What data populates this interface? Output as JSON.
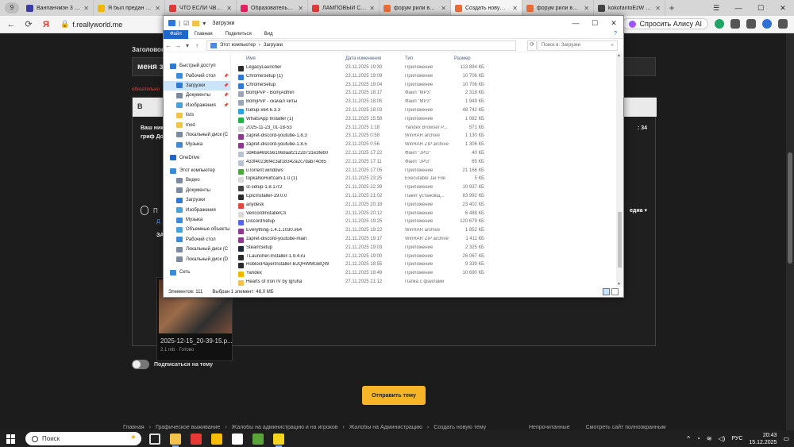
{
  "browser": {
    "tab_counter": "9",
    "tabs": [
      {
        "title": "Ванпанчмэн 3 сезон",
        "color": "#3a3aa8",
        "active": false
      },
      {
        "title": "Я был предан товар",
        "color": "#f4b400",
        "active": false
      },
      {
        "title": "ЧТО ЕСЛИ ЧВК \"ВАГ",
        "color": "#e53935",
        "active": false
      },
      {
        "title": "Образовательный п",
        "color": "#e91e63",
        "active": false
      },
      {
        "title": "ЛАМПОВЫЙ СТР",
        "color": "#e53935",
        "active": false
      },
      {
        "title": "форум рили ворлд -",
        "color": "#ef6c36",
        "active": false
      },
      {
        "title": "Создать новую те",
        "color": "#ef6c36",
        "active": true
      },
      {
        "title": "форум рили ворлд",
        "color": "#ef6c36",
        "active": false
      },
      {
        "title": "kokofantoEzW - Reali",
        "color": "#444444",
        "active": false
      }
    ],
    "url": "f.reallyworld.me",
    "alice_label": "Спросить Алису AI"
  },
  "forum": {
    "header": "Заголовок",
    "title_value": "меня за",
    "required_note": "обязательно",
    "editor_bold": "B",
    "editor_line1": "Ваш ник:",
    "editor_line2": "гриф Дом",
    "editor_right": ": 34",
    "attach_label": "П",
    "media_dropdown": "едиа ▾",
    "link_letter": "Д",
    "section_letter": "ЗА",
    "attachment": {
      "filename": "2025-12-15_20-39-15.p...",
      "meta": "2.1 mb · Готово"
    },
    "subscribe_label": "Подписаться на тему",
    "submit_label": "Отправить тему",
    "footer_crumbs": [
      "Главная",
      "›",
      "Графическое выживание",
      "›",
      "Жалобы на администрацию и на игроков",
      "›",
      "Жалобы на Администрацию",
      "›",
      "Создать новую тему"
    ],
    "footer_right": [
      "Непрочитанные",
      "Смотреть сайт полноэкранным"
    ]
  },
  "explorer": {
    "title": "Загрузки",
    "ribbon_tabs": [
      "Файл",
      "Главная",
      "Поделиться",
      "Вид"
    ],
    "path": [
      "Этот компьютер",
      "›",
      "Загрузки"
    ],
    "search_placeholder": "Поиск в: Загрузки",
    "columns": {
      "name": "Имя",
      "date": "Дата изменения",
      "type": "Тип",
      "size": "Размер"
    },
    "nav": [
      {
        "label": "Быстрый доступ",
        "level": 1,
        "color": "#2f78d4",
        "pin": false,
        "selected": false
      },
      {
        "label": "Рабочий стол",
        "level": 2,
        "color": "#3b8bd9",
        "pin": true,
        "selected": false
      },
      {
        "label": "Загрузки",
        "level": 2,
        "color": "#2f78d4",
        "pin": true,
        "selected": true
      },
      {
        "label": "Документы",
        "level": 2,
        "color": "#7a8aa0",
        "pin": true,
        "selected": false
      },
      {
        "label": "Изображения",
        "level": 2,
        "color": "#4aa0d8",
        "pin": true,
        "selected": false
      },
      {
        "label": "lists",
        "level": 2,
        "color": "#f3c24d",
        "pin": false,
        "selected": false
      },
      {
        "label": "mod",
        "level": 2,
        "color": "#f3c24d",
        "pin": false,
        "selected": false
      },
      {
        "label": "Локальный диск (C",
        "level": 2,
        "color": "#7a8aa0",
        "pin": false,
        "selected": false
      },
      {
        "label": "Музыка",
        "level": 2,
        "color": "#3b8bd9",
        "pin": false,
        "selected": false
      },
      {
        "label": "",
        "level": 0,
        "color": "",
        "pin": false,
        "selected": false
      },
      {
        "label": "OneDrive",
        "level": 1,
        "color": "#1c67c9",
        "pin": false,
        "selected": false
      },
      {
        "label": "",
        "level": 0,
        "color": "",
        "pin": false,
        "selected": false
      },
      {
        "label": "Этот компьютер",
        "level": 1,
        "color": "#3b8bd9",
        "pin": false,
        "selected": false
      },
      {
        "label": "Видео",
        "level": 2,
        "color": "#7a8aa0",
        "pin": false,
        "selected": false
      },
      {
        "label": "Документы",
        "level": 2,
        "color": "#7a8aa0",
        "pin": false,
        "selected": false
      },
      {
        "label": "Загрузки",
        "level": 2,
        "color": "#2f78d4",
        "pin": false,
        "selected": false
      },
      {
        "label": "Изображения",
        "level": 2,
        "color": "#4aa0d8",
        "pin": false,
        "selected": false
      },
      {
        "label": "Музыка",
        "level": 2,
        "color": "#3b8bd9",
        "pin": false,
        "selected": false
      },
      {
        "label": "Объемные объекты",
        "level": 2,
        "color": "#4aa0d8",
        "pin": false,
        "selected": false
      },
      {
        "label": "Рабочий стол",
        "level": 2,
        "color": "#3b8bd9",
        "pin": false,
        "selected": false
      },
      {
        "label": "Локальный диск (C",
        "level": 2,
        "color": "#7a8aa0",
        "pin": false,
        "selected": false
      },
      {
        "label": "Локальный диск (D",
        "level": 2,
        "color": "#7a8aa0",
        "pin": false,
        "selected": false
      },
      {
        "label": "",
        "level": 0,
        "color": "",
        "pin": false,
        "selected": false
      },
      {
        "label": "Сеть",
        "level": 1,
        "color": "#3b8bd9",
        "pin": false,
        "selected": false
      }
    ],
    "files": [
      {
        "name": "LegacyLauncher",
        "date": "23.11.2025 19:30",
        "type": "Приложение",
        "size": "113 894 КБ",
        "icon": "#2b2b2b"
      },
      {
        "name": "ChromeSetup (1)",
        "date": "23.11.2025 19:09",
        "type": "Приложение",
        "size": "10 706 КБ",
        "icon": "#2f78d4"
      },
      {
        "name": "ChromeSetup",
        "date": "23.11.2025 19:04",
        "type": "Приложение",
        "size": "10 706 КБ",
        "icon": "#2f78d4"
      },
      {
        "name": "BomjPvP - BomjAdmin",
        "date": "23.11.2025 18:17",
        "type": "Файл \"MP3\"",
        "size": "2 318 КБ",
        "icon": "#9aa5b5"
      },
      {
        "name": "BomjPvP - скачал читы",
        "date": "23.11.2025 18:05",
        "type": "Файл \"MP3\"",
        "size": "1 949 КБ",
        "icon": "#9aa5b5"
      },
      {
        "name": "tsetup-x64.6.3.3",
        "date": "23.11.2025 18:03",
        "type": "Приложение",
        "size": "48 742 КБ",
        "icon": "#2aa3e0"
      },
      {
        "name": "WhatsApp Installer (1)",
        "date": "23.11.2025 15:58",
        "type": "Приложение",
        "size": "1 082 КБ",
        "icon": "#25b04a"
      },
      {
        "name": "2025-11-23_01-18-53",
        "date": "23.11.2025 1:18",
        "type": "Yandex Browser P...",
        "size": "571 КБ",
        "icon": "#d9d9d9"
      },
      {
        "name": "zapret-discord-youtube-1.8.3",
        "date": "23.11.2025 0:58",
        "type": "WinRAR archive",
        "size": "1 130 КБ",
        "icon": "#8b3a8e"
      },
      {
        "name": "zapret-discord-youtube-1.8.5",
        "date": "23.11.2025 0:56",
        "type": "WinRAR ZIP archive",
        "size": "1 306 КБ",
        "icon": "#8b3a8e"
      },
      {
        "name": "3d4ba469c561068aaf2122d731e3feb0",
        "date": "22.11.2025 17:22",
        "type": "Файл \"JPG\"",
        "size": "40 КБ",
        "icon": "#b9c2cf"
      },
      {
        "name": "433f40236f4c3af18342a2c7dab74c65",
        "date": "22.11.2025 17:11",
        "type": "Файл \"JPG\"",
        "size": "65 КБ",
        "icon": "#b9c2cf"
      },
      {
        "name": "uTorrent.windows",
        "date": "22.11.2025 17:05",
        "type": "Приложение",
        "size": "21 166 КБ",
        "icon": "#4aa83a"
      },
      {
        "name": "topkaNoHurtcam-1.0 (1)",
        "date": "21.11.2025 23:25",
        "type": "Executable Jar File",
        "size": "5 КБ",
        "icon": "#d9d9d9"
      },
      {
        "name": "st-setup-1.8.17r2",
        "date": "21.11.2025 22:39",
        "type": "Приложение",
        "size": "10 937 КБ",
        "icon": "#444444"
      },
      {
        "name": "EpicInstaller-19.0.0",
        "date": "21.11.2025 21:02",
        "type": "Пакет установщ...",
        "size": "83 992 КБ",
        "icon": "#2b2b2b"
      },
      {
        "name": "anydesk",
        "date": "21.11.2025 20:18",
        "type": "Приложение",
        "size": "23 402 КБ",
        "icon": "#e2483d"
      },
      {
        "name": "VencordInstallerCli",
        "date": "21.11.2025 20:12",
        "type": "Приложение",
        "size": "6 488 КБ",
        "icon": "#d9d9d9"
      },
      {
        "name": "DiscordSetup",
        "date": "21.11.2025 19:25",
        "type": "Приложение",
        "size": "120 679 КБ",
        "icon": "#5865f2"
      },
      {
        "name": "Everything-1.4.1.1030.x64",
        "date": "21.11.2025 19:22",
        "type": "WinRAR archive",
        "size": "1 852 КБ",
        "icon": "#8b3a8e"
      },
      {
        "name": "zapret-discord-youtube-main",
        "date": "21.11.2025 19:17",
        "type": "WinRAR ZIP archive",
        "size": "1 411 КБ",
        "icon": "#8b3a8e"
      },
      {
        "name": "SteamSetup",
        "date": "21.11.2025 19:03",
        "type": "Приложение",
        "size": "2 325 КБ",
        "icon": "#1b2838"
      },
      {
        "name": "TLauncher-Installer-1.9.4-ru",
        "date": "21.11.2025 19:00",
        "type": "Приложение",
        "size": "26 067 КБ",
        "icon": "#2b2b2b"
      },
      {
        "name": "RobloxPlayerInstaller-BJQHWMGBQW",
        "date": "21.11.2025 18:55",
        "type": "Приложение",
        "size": "9 339 КБ",
        "icon": "#2b2b2b"
      },
      {
        "name": "Yandex",
        "date": "21.11.2025 18:49",
        "type": "Приложение",
        "size": "10 690 КБ",
        "icon": "#f4b400"
      },
      {
        "name": "Hearts of Iron IV by Igruha",
        "date": "27.11.2025 21:12",
        "type": "Папка с файлами",
        "size": "",
        "icon": "#f3c24d"
      }
    ],
    "status_items": "Элементов: 111",
    "status_selected": "Выбран 1 элемент: 48,0 МБ"
  },
  "taskbar": {
    "search_placeholder": "Поиск",
    "apps": [
      {
        "name": "taskview-icon",
        "color": "#dddddd",
        "active": false
      },
      {
        "name": "explorer-icon",
        "color": "#f3c24d",
        "active": true
      },
      {
        "name": "yandex-music-icon",
        "color": "#e53935",
        "active": false
      },
      {
        "name": "chrome-icon",
        "color": "#fbbc05",
        "active": false
      },
      {
        "name": "yandex-browser-icon",
        "color": "#ffffff",
        "active": false
      },
      {
        "name": "minecraft-icon",
        "color": "#5aa53a",
        "active": false
      },
      {
        "name": "app-yellow-icon",
        "color": "#f6d31f",
        "active": true
      }
    ],
    "lang": "РУС",
    "time": "20:43",
    "date": "15.12.2025"
  }
}
